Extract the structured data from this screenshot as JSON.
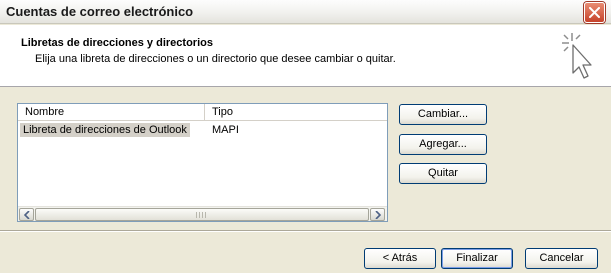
{
  "window": {
    "title": "Cuentas de correo electrónico",
    "close_icon": "close-icon"
  },
  "header": {
    "title": "Libretas de direcciones y directorios",
    "subtitle": "Elija una libreta de direcciones o un directorio que desee cambiar o quitar.",
    "icon": "wizard-cursor-icon"
  },
  "list": {
    "columns": [
      "Nombre",
      "Tipo"
    ],
    "rows": [
      {
        "nombre": "Libreta de direcciones de Outlook",
        "tipo": "MAPI",
        "selected": true
      }
    ]
  },
  "side_buttons": {
    "cambiar": "Cambiar...",
    "agregar": "Agregar...",
    "quitar": "Quitar"
  },
  "footer_buttons": {
    "atras": "< Atrás",
    "finalizar": "Finalizar",
    "cancelar": "Cancelar"
  },
  "colors": {
    "dialog_bg": "#ece9d8",
    "close_button": "#c6422a",
    "selected_row": "#d4d0c8",
    "button_border": "#003c74"
  }
}
